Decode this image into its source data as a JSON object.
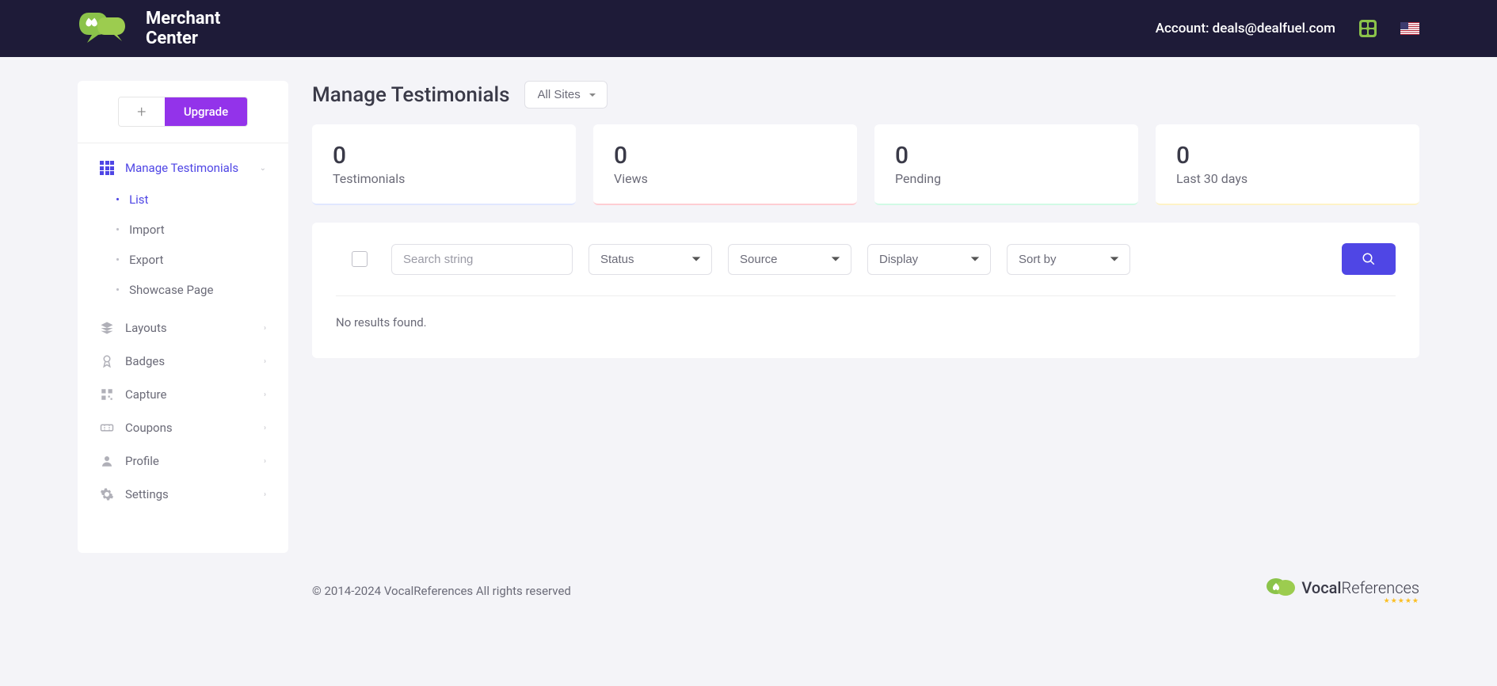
{
  "header": {
    "logo_line1": "Merchant",
    "logo_line2": "Center",
    "account_label": "Account: deals@dealfuel.com"
  },
  "sidebar": {
    "plus": "+",
    "upgrade": "Upgrade",
    "nav": {
      "manage_testimonials": "Manage Testimonials",
      "layouts": "Layouts",
      "badges": "Badges",
      "capture": "Capture",
      "coupons": "Coupons",
      "profile": "Profile",
      "settings": "Settings"
    },
    "subnav": {
      "list": "List",
      "import": "Import",
      "export": "Export",
      "showcase": "Showcase Page"
    }
  },
  "page": {
    "title": "Manage Testimonials",
    "site_select": "All Sites"
  },
  "stats": [
    {
      "value": "0",
      "label": "Testimonials"
    },
    {
      "value": "0",
      "label": "Views"
    },
    {
      "value": "0",
      "label": "Pending"
    },
    {
      "value": "0",
      "label": "Last 30 days"
    }
  ],
  "filters": {
    "search_placeholder": "Search string",
    "status": "Status",
    "source": "Source",
    "display": "Display",
    "sort": "Sort by"
  },
  "results": {
    "empty": "No results found."
  },
  "footer": {
    "copyright": "© 2014-2024 VocalReferences All rights reserved",
    "brand_a": "Vocal",
    "brand_b": "References",
    "stars": "★★★★★"
  }
}
